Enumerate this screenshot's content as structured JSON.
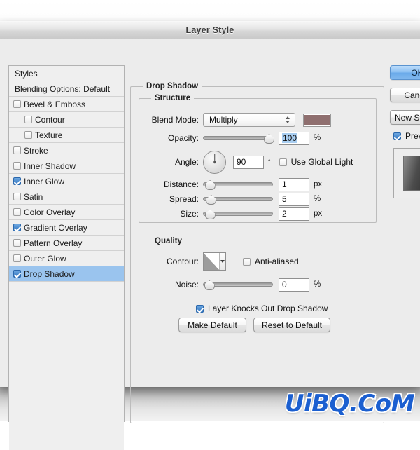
{
  "window": {
    "title": "Layer Style"
  },
  "styles_panel": {
    "header": "Styles",
    "blending_options": "Blending Options: Default",
    "items": [
      {
        "label": "Bevel & Emboss",
        "checked": false,
        "sub": false,
        "selected": false
      },
      {
        "label": "Contour",
        "checked": false,
        "sub": true,
        "selected": false
      },
      {
        "label": "Texture",
        "checked": false,
        "sub": true,
        "selected": false
      },
      {
        "label": "Stroke",
        "checked": false,
        "sub": false,
        "selected": false
      },
      {
        "label": "Inner Shadow",
        "checked": false,
        "sub": false,
        "selected": false
      },
      {
        "label": "Inner Glow",
        "checked": true,
        "sub": false,
        "selected": false
      },
      {
        "label": "Satin",
        "checked": false,
        "sub": false,
        "selected": false
      },
      {
        "label": "Color Overlay",
        "checked": false,
        "sub": false,
        "selected": false
      },
      {
        "label": "Gradient Overlay",
        "checked": true,
        "sub": false,
        "selected": false
      },
      {
        "label": "Pattern Overlay",
        "checked": false,
        "sub": false,
        "selected": false
      },
      {
        "label": "Outer Glow",
        "checked": false,
        "sub": false,
        "selected": false
      },
      {
        "label": "Drop Shadow",
        "checked": true,
        "sub": false,
        "selected": true
      }
    ]
  },
  "effect": {
    "group_title": "Drop Shadow",
    "structure": {
      "title": "Structure",
      "blend_mode_label": "Blend Mode:",
      "blend_mode_value": "Multiply",
      "shadow_color": "#8f6f6f",
      "opacity_label": "Opacity:",
      "opacity_value": "100",
      "opacity_unit": "%",
      "opacity_percent": 100,
      "angle_label": "Angle:",
      "angle_value": "90",
      "angle_unit": "°",
      "use_global_light_label": "Use Global Light",
      "use_global_light_checked": false,
      "distance_label": "Distance:",
      "distance_value": "1",
      "distance_unit": "px",
      "distance_percent": 3,
      "spread_label": "Spread:",
      "spread_value": "5",
      "spread_unit": "%",
      "spread_percent": 5,
      "size_label": "Size:",
      "size_value": "2",
      "size_unit": "px",
      "size_percent": 3
    },
    "quality": {
      "title": "Quality",
      "contour_label": "Contour:",
      "anti_aliased_label": "Anti-aliased",
      "anti_aliased_checked": false,
      "noise_label": "Noise:",
      "noise_value": "0",
      "noise_unit": "%",
      "noise_percent": 2
    },
    "knockout_label": "Layer Knocks Out Drop Shadow",
    "knockout_checked": true,
    "make_default_label": "Make Default",
    "reset_default_label": "Reset to Default"
  },
  "actions": {
    "ok_label": "OK",
    "cancel_label": "Cancel",
    "new_style_label": "New Style...",
    "preview_label": "Preview",
    "preview_checked": true
  },
  "watermark": {
    "text": "UiBQ.CoM",
    "color": "#1b5fd0"
  }
}
